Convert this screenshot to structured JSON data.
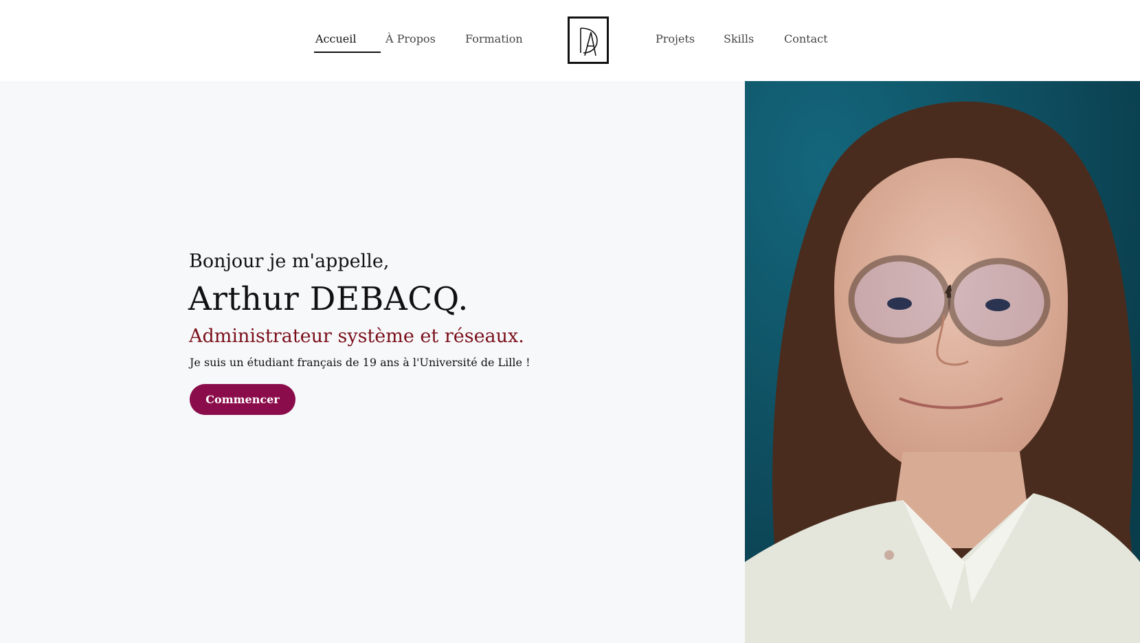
{
  "nav": {
    "left_items": [
      "Accueil",
      "À Propos",
      "Formation"
    ],
    "right_items": [
      "Projets",
      "Skills",
      "Contact"
    ],
    "active": "Accueil",
    "logo_icon": "da-monogram-icon"
  },
  "hero": {
    "greeting": "Bonjour je m'appelle,",
    "name": "Arthur DEBACQ.",
    "role": "Administrateur système et réseaux.",
    "bio": "Je suis un étudiant français de 19 ans à l'Université de Lille !",
    "cta_label": "Commencer"
  },
  "colors": {
    "accent_button": "#8a0c4a",
    "role_text": "#7a0f1a",
    "hero_background": "#f7f8fa"
  }
}
